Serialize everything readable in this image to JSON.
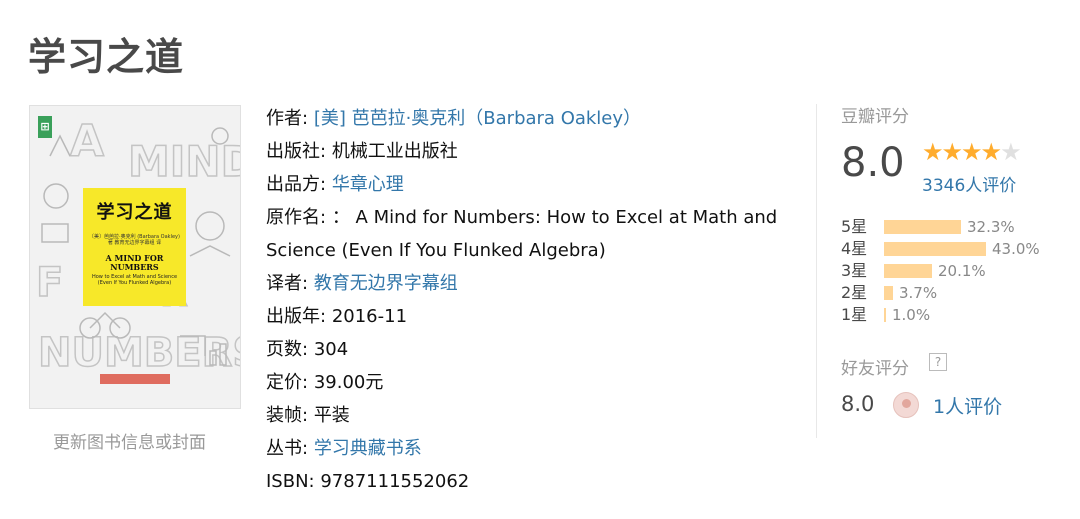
{
  "page_title": "学习之道",
  "cover": {
    "title": "学习之道",
    "author_line": "〔美〕芭芭拉·奥克利 (Barbara Oakley) 著\n教育无边界字幕组 译",
    "en_title": "A MIND FOR NUMBERS",
    "en_subtitle": "How to Excel at Math and Science (Even If You Flunked Algebra)",
    "update_link": "更新图书信息或封面"
  },
  "info": {
    "author_label": "作者:",
    "author_value": "[美] 芭芭拉·奥克利（Barbara Oakley）",
    "publisher_label": "出版社:",
    "publisher_value": "机械工业出版社",
    "producer_label": "出品方:",
    "producer_value": "华章心理",
    "original_title_label": "原作名:",
    "original_title_value": "：  A Mind for Numbers: How to Excel at Math and",
    "original_title_value_2": "Science (Even If You Flunked Algebra)",
    "translator_label": "译者:",
    "translator_value": "教育无边界字幕组",
    "year_label": "出版年:",
    "year_value": "2016-11",
    "pages_label": "页数:",
    "pages_value": "304",
    "price_label": "定价:",
    "price_value": "39.00元",
    "binding_label": "装帧:",
    "binding_value": "平装",
    "series_label": "丛书:",
    "series_value": "学习典藏书系",
    "isbn_label": "ISBN:",
    "isbn_value": "9787111552062"
  },
  "rating": {
    "label": "豆瓣评分",
    "score": "8.0",
    "stars_filled": 4,
    "stars_total": 5,
    "count_text": "3346人评价",
    "bar_color": "#ffd596",
    "star_color": "#ffac2d",
    "breakdown": [
      {
        "label": "5星",
        "pct_text": "32.3%",
        "pct": 32.3
      },
      {
        "label": "4星",
        "pct_text": "43.0%",
        "pct": 43.0
      },
      {
        "label": "3星",
        "pct_text": "20.1%",
        "pct": 20.1
      },
      {
        "label": "2星",
        "pct_text": "3.7%",
        "pct": 3.7
      },
      {
        "label": "1星",
        "pct_text": "1.0%",
        "pct": 1.0
      }
    ]
  },
  "friends": {
    "label": "好友评分",
    "help": "?",
    "score": "8.0",
    "count_text": "1人评价"
  }
}
